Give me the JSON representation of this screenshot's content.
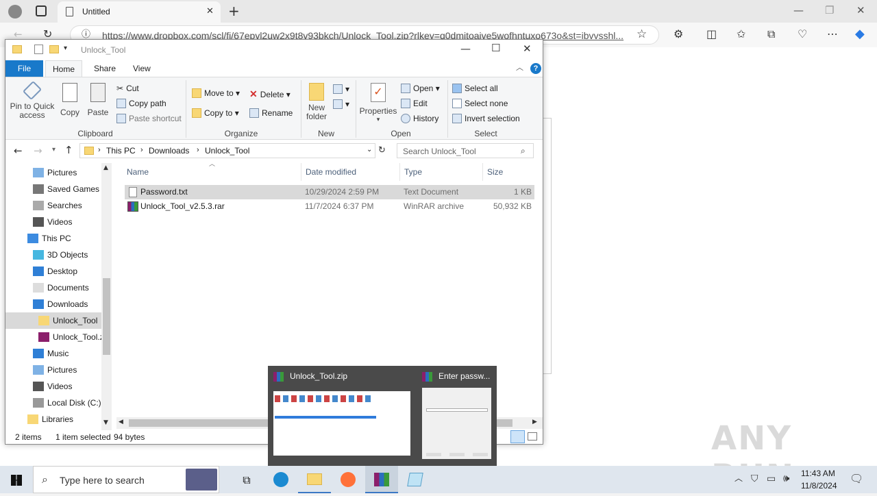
{
  "browser": {
    "tab_title": "Untitled",
    "url": "https://www.dropbox.com/scl/fi/67epvl2uw2x9t8v93bkch/Unlock_Tool.zip?rlkey=q0dmitoaive5wofhntuxo673o&st=ibvvsshl..."
  },
  "explorer": {
    "title": "Unlock_Tool",
    "tabs": [
      "File",
      "Home",
      "Share",
      "View"
    ],
    "ribbon": {
      "clipboard": {
        "pin": "Pin to Quick access",
        "copy": "Copy",
        "paste": "Paste",
        "cut": "Cut",
        "copy_path": "Copy path",
        "paste_shortcut": "Paste shortcut",
        "label": "Clipboard"
      },
      "organize": {
        "move_to": "Move to",
        "copy_to": "Copy to",
        "delete": "Delete",
        "rename": "Rename",
        "label": "Organize"
      },
      "new": {
        "new_folder": "New folder",
        "label": "New"
      },
      "open": {
        "properties": "Properties",
        "open": "Open",
        "edit": "Edit",
        "history": "History",
        "label": "Open"
      },
      "select": {
        "select_all": "Select all",
        "select_none": "Select none",
        "invert": "Invert selection",
        "label": "Select"
      }
    },
    "breadcrumb": [
      "This PC",
      "Downloads",
      "Unlock_Tool"
    ],
    "search_placeholder": "Search Unlock_Tool",
    "tree": [
      {
        "label": "Pictures",
        "indent": 1,
        "icon": "pictures-icon"
      },
      {
        "label": "Saved Games",
        "indent": 1,
        "icon": "saved-games-icon"
      },
      {
        "label": "Searches",
        "indent": 1,
        "icon": "searches-icon"
      },
      {
        "label": "Videos",
        "indent": 1,
        "icon": "videos-icon"
      },
      {
        "label": "This PC",
        "indent": 0,
        "icon": "this-pc-icon"
      },
      {
        "label": "3D Objects",
        "indent": 1,
        "icon": "3d-objects-icon"
      },
      {
        "label": "Desktop",
        "indent": 1,
        "icon": "desktop-icon"
      },
      {
        "label": "Documents",
        "indent": 1,
        "icon": "documents-icon"
      },
      {
        "label": "Downloads",
        "indent": 1,
        "icon": "downloads-icon"
      },
      {
        "label": "Unlock_Tool",
        "indent": 2,
        "icon": "folder-icon"
      },
      {
        "label": "Unlock_Tool.z",
        "indent": 2,
        "icon": "winrar-icon"
      },
      {
        "label": "Music",
        "indent": 1,
        "icon": "music-icon"
      },
      {
        "label": "Pictures",
        "indent": 1,
        "icon": "pictures-icon"
      },
      {
        "label": "Videos",
        "indent": 1,
        "icon": "videos-icon"
      },
      {
        "label": "Local Disk (C:)",
        "indent": 1,
        "icon": "local-disk-icon"
      },
      {
        "label": "Libraries",
        "indent": 0,
        "icon": "libraries-icon"
      }
    ],
    "columns": {
      "name": "Name",
      "date": "Date modified",
      "type": "Type",
      "size": "Size"
    },
    "files": [
      {
        "name": "Password.txt",
        "date": "10/29/2024 2:59 PM",
        "type": "Text Document",
        "size": "1 KB"
      },
      {
        "name": "Unlock_Tool_v2.5.3.rar",
        "date": "11/7/2024 6:37 PM",
        "type": "WinRAR archive",
        "size": "50,932 KB"
      }
    ],
    "status": {
      "count": "2 items",
      "selected": "1 item selected",
      "bytes": "94 bytes"
    }
  },
  "thumbnails": [
    {
      "title": "Unlock_Tool.zip"
    },
    {
      "title": "Enter passw..."
    }
  ],
  "taskbar": {
    "search_placeholder": "Type here to search",
    "time": "11:43 AM",
    "date": "11/8/2024"
  },
  "watermark": "ANY RUN"
}
